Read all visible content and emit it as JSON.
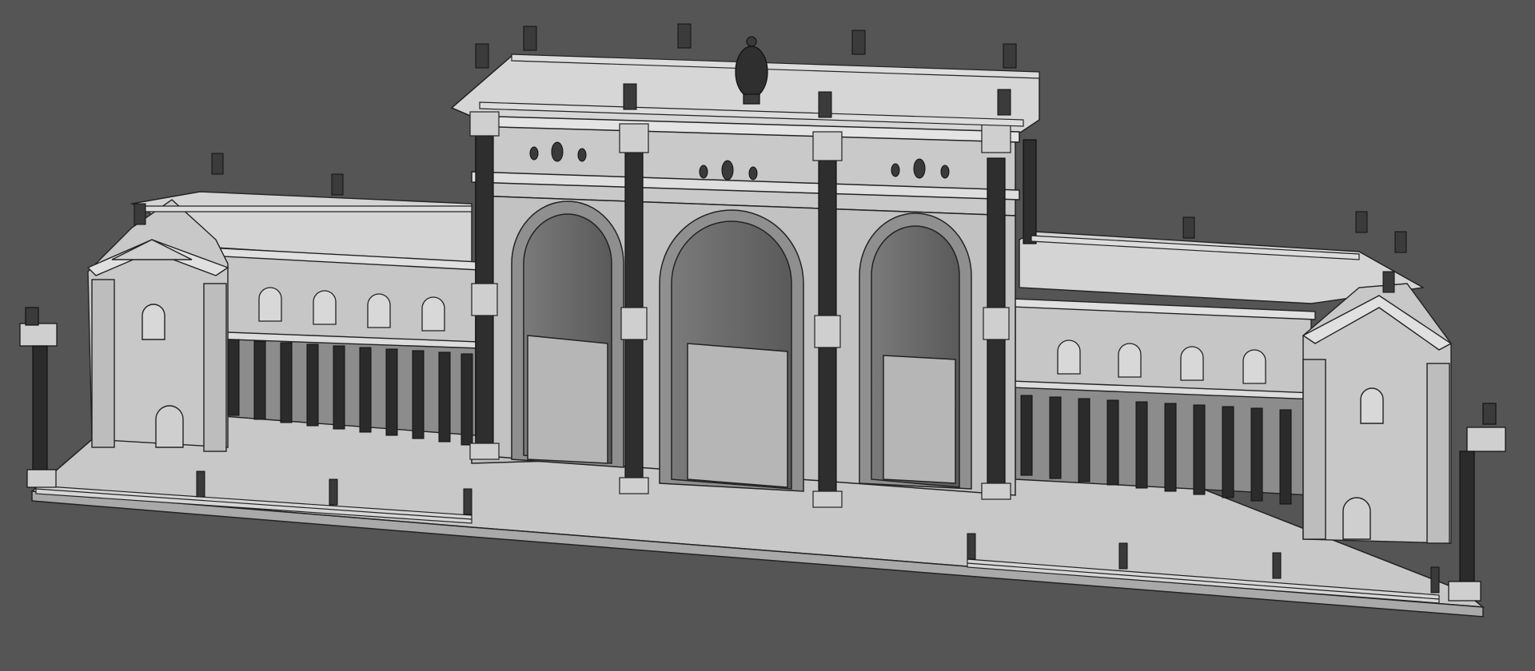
{
  "viewport": {
    "background": "#555555",
    "render_style": "shaded-wireframe",
    "subject": "triumphal-arch-with-colonnaded-wings",
    "arch_openings": 3,
    "wing_colonnade_columns_per_side": 10,
    "wing_upper_windows_per_side": 4,
    "freestanding_columns": 2
  },
  "palette": {
    "wall": "#c4c4c4",
    "wall_shadow": "#9a9a9a",
    "roof": "#d2d2d2",
    "column": "#2a2a2a",
    "line": "#222222",
    "dark_opening": "#5b5b5b",
    "ground": "#cdcdcd"
  }
}
